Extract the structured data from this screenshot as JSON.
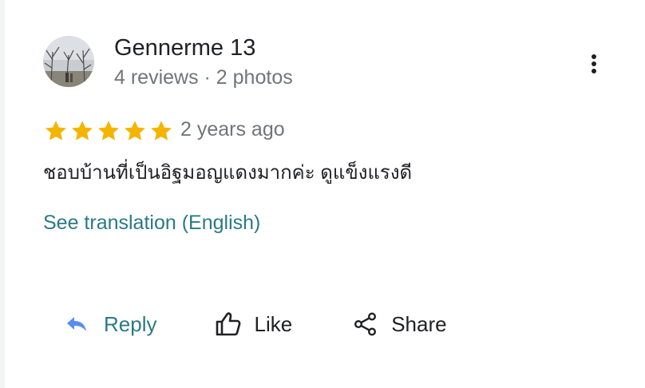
{
  "reviewer": {
    "name": "Gennerme 13",
    "meta": "4 reviews · 2 photos"
  },
  "rating": {
    "stars": 5,
    "max": 5,
    "star_color": "#f4b400",
    "time": "2 years ago"
  },
  "review_text": "ชอบบ้านที่เป็นอิฐมอญแดงมากค่ะ ดูแข็งแรงดี",
  "translate_label": "See translation (English)",
  "actions": {
    "reply_label": "Reply",
    "like_label": "Like",
    "share_label": "Share"
  },
  "icons": {
    "more": "more-vert-icon",
    "reply": "reply-arrow-icon",
    "like": "thumb-up-icon",
    "share": "share-icon"
  },
  "colors": {
    "link": "#2a7a85",
    "reply_icon": "#5b8def",
    "secondary_text": "#70757a",
    "primary_text": "#202124"
  }
}
